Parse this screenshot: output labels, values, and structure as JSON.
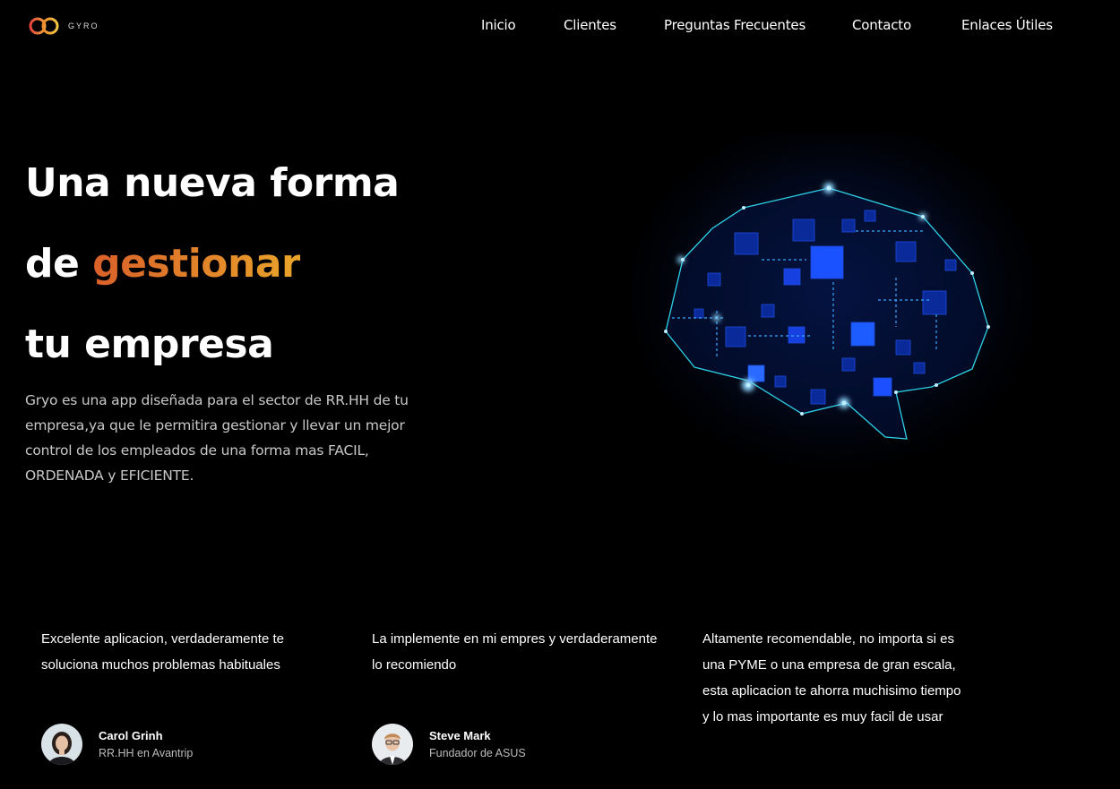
{
  "brand": {
    "name": "GYRO"
  },
  "nav": {
    "items": [
      "Inicio",
      "Clientes",
      "Preguntas Frecuentes",
      "Contacto",
      "Enlaces Útiles"
    ]
  },
  "hero": {
    "title_line1": "Una nueva forma",
    "title_line2_prefix": "de ",
    "title_line2_accent": "gestionar",
    "title_line3": "tu empresa",
    "description": "Gryo es una app diseñada para el sector de RR.HH de tu empresa,ya que le permitira gestionar y llevar un mejor control de los empleados de una forma mas FACIL, ORDENADA y EFICIENTE."
  },
  "testimonials": [
    {
      "quote": "Excelente aplicacion, verdaderamente te soluciona muchos problemas habituales",
      "name": "Carol Grinh",
      "role": "RR.HH en Avantrip"
    },
    {
      "quote": "La implemente en mi empres y verdaderamente lo recomiendo",
      "name": "Steve Mark",
      "role": "Fundador de ASUS"
    },
    {
      "quote": "Altamente recomendable, no importa si es una PYME o una empresa de gran escala, esta aplicacion te ahorra muchisimo tiempo y lo mas importante es muy facil de usar"
    }
  ],
  "colors": {
    "background": "#000000",
    "accent_start": "#d9602a",
    "accent_end": "#eaa42a",
    "brain_glow": "#1a4dff"
  },
  "icons": {
    "logo": "interlocked-rings-logo",
    "hero_image": "circuit-brain-illustration"
  }
}
